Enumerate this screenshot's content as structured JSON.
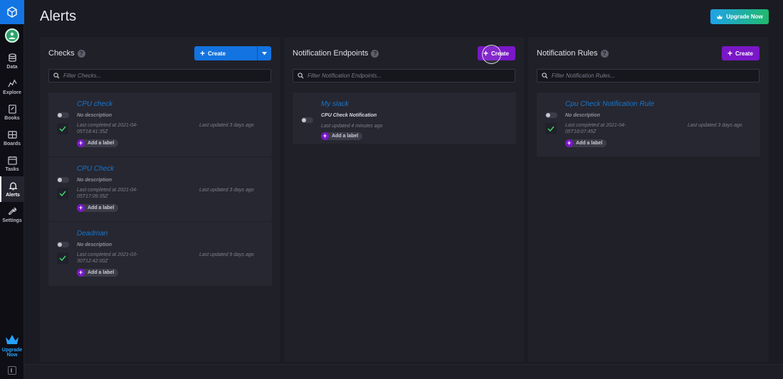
{
  "page": {
    "title": "Alerts"
  },
  "upgrade": {
    "label": "Upgrade Now",
    "sidebar_label": "Upgrade Now"
  },
  "sidebar": {
    "items": [
      {
        "label": "Data",
        "icon": "database-icon"
      },
      {
        "label": "Explore",
        "icon": "graph-icon"
      },
      {
        "label": "Books",
        "icon": "notebook-icon"
      },
      {
        "label": "Boards",
        "icon": "dashboard-icon"
      },
      {
        "label": "Tasks",
        "icon": "calendar-icon"
      },
      {
        "label": "Alerts",
        "icon": "bell-icon"
      },
      {
        "label": "Settings",
        "icon": "wrench-icon"
      }
    ]
  },
  "checks": {
    "title": "Checks",
    "create_label": "Create",
    "search_placeholder": "Filter Checks...",
    "items": [
      {
        "name": "CPU check",
        "description": "No description",
        "completed": "Last completed at 2021-04-05T18:41:35Z",
        "updated": "Last updated 3 days ago",
        "add_label": "Add a label"
      },
      {
        "name": "CPU Check",
        "description": "No description",
        "completed": "Last completed at 2021-04-05T17:09:35Z",
        "updated": "Last updated 3 days ago",
        "add_label": "Add a label"
      },
      {
        "name": "Deadman",
        "description": "No description",
        "completed": "Last completed at 2021-03-30T12:42:00Z",
        "updated": "Last updated 9 days ago",
        "add_label": "Add a label"
      }
    ]
  },
  "endpoints": {
    "title": "Notification Endpoints",
    "create_label": "Create",
    "search_placeholder": "Filter Notification Endpoints...",
    "items": [
      {
        "name": "My slack",
        "description": "CPU Check Notification",
        "updated": "Last updated 4 minutes ago",
        "add_label": "Add a label"
      }
    ]
  },
  "rules": {
    "title": "Notification Rules",
    "create_label": "Create",
    "search_placeholder": "Filter Notification Rules...",
    "items": [
      {
        "name": "Cpu Check Notification Rule",
        "description": "No description",
        "completed": "Last completed at 2021-04-05T18:07:45Z",
        "updated": "Last updated 3 days ago",
        "add_label": "Add a label"
      }
    ]
  },
  "colors": {
    "accent_blue": "#1373e0",
    "accent_purple": "#7a17c7",
    "success": "#3fd56a"
  }
}
